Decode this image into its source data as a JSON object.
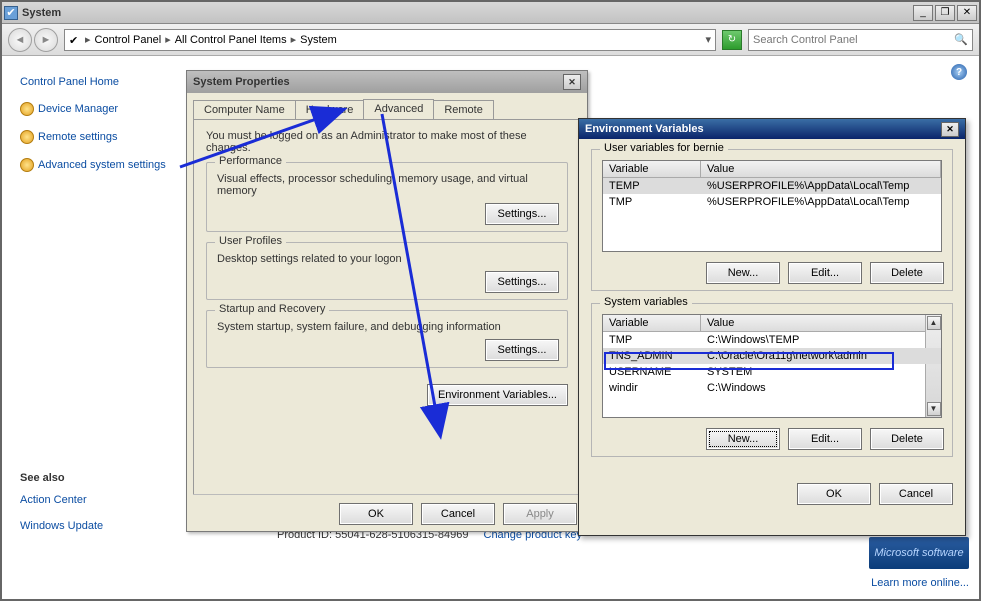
{
  "window": {
    "title": "System",
    "min_label": "_",
    "restore_label": "❐",
    "close_label": "✕"
  },
  "nav": {
    "crumb1": "Control Panel",
    "crumb2": "All Control Panel Items",
    "crumb3": "System",
    "search_placeholder": "Search Control Panel"
  },
  "left": {
    "home": "Control Panel Home",
    "device_mgr": "Device Manager",
    "remote": "Remote settings",
    "adv": "Advanced system settings",
    "see_also": "See also",
    "action_center": "Action Center",
    "win_update": "Windows Update"
  },
  "sp": {
    "title": "System Properties",
    "tabs": {
      "computer": "Computer Name",
      "hardware": "Hardware",
      "advanced": "Advanced",
      "remote": "Remote"
    },
    "intro": "You must be logged on as an Administrator to make most of these changes.",
    "perf": {
      "legend": "Performance",
      "desc": "Visual effects, processor scheduling, memory usage, and virtual memory",
      "btn": "Settings..."
    },
    "profiles": {
      "legend": "User Profiles",
      "desc": "Desktop settings related to your logon",
      "btn": "Settings..."
    },
    "startup": {
      "legend": "Startup and Recovery",
      "desc": "System startup, system failure, and debugging information",
      "btn": "Settings..."
    },
    "env_btn": "Environment Variables...",
    "ok": "OK",
    "cancel": "Cancel",
    "apply": "Apply"
  },
  "ev": {
    "title": "Environment Variables",
    "user_legend": "User variables for bernie",
    "sys_legend": "System variables",
    "cols": {
      "var": "Variable",
      "val": "Value"
    },
    "user_rows": [
      {
        "var": "TEMP",
        "val": "%USERPROFILE%\\AppData\\Local\\Temp"
      },
      {
        "var": "TMP",
        "val": "%USERPROFILE%\\AppData\\Local\\Temp"
      }
    ],
    "sys_rows": [
      {
        "var": "TMP",
        "val": "C:\\Windows\\TEMP"
      },
      {
        "var": "TNS_ADMIN",
        "val": "C:\\Oracle\\Ora11g\\network\\admin"
      },
      {
        "var": "USERNAME",
        "val": "SYSTEM"
      },
      {
        "var": "windir",
        "val": "C:\\Windows"
      }
    ],
    "new": "New...",
    "edit": "Edit...",
    "del": "Delete",
    "ok": "OK",
    "cancel": "Cancel"
  },
  "footer": {
    "product_id_label": "Product ID:",
    "product_id": "55041-628-5106315-84969",
    "change_key": "Change product key",
    "ms_badge": "Microsoft software",
    "learn": "Learn more online..."
  }
}
